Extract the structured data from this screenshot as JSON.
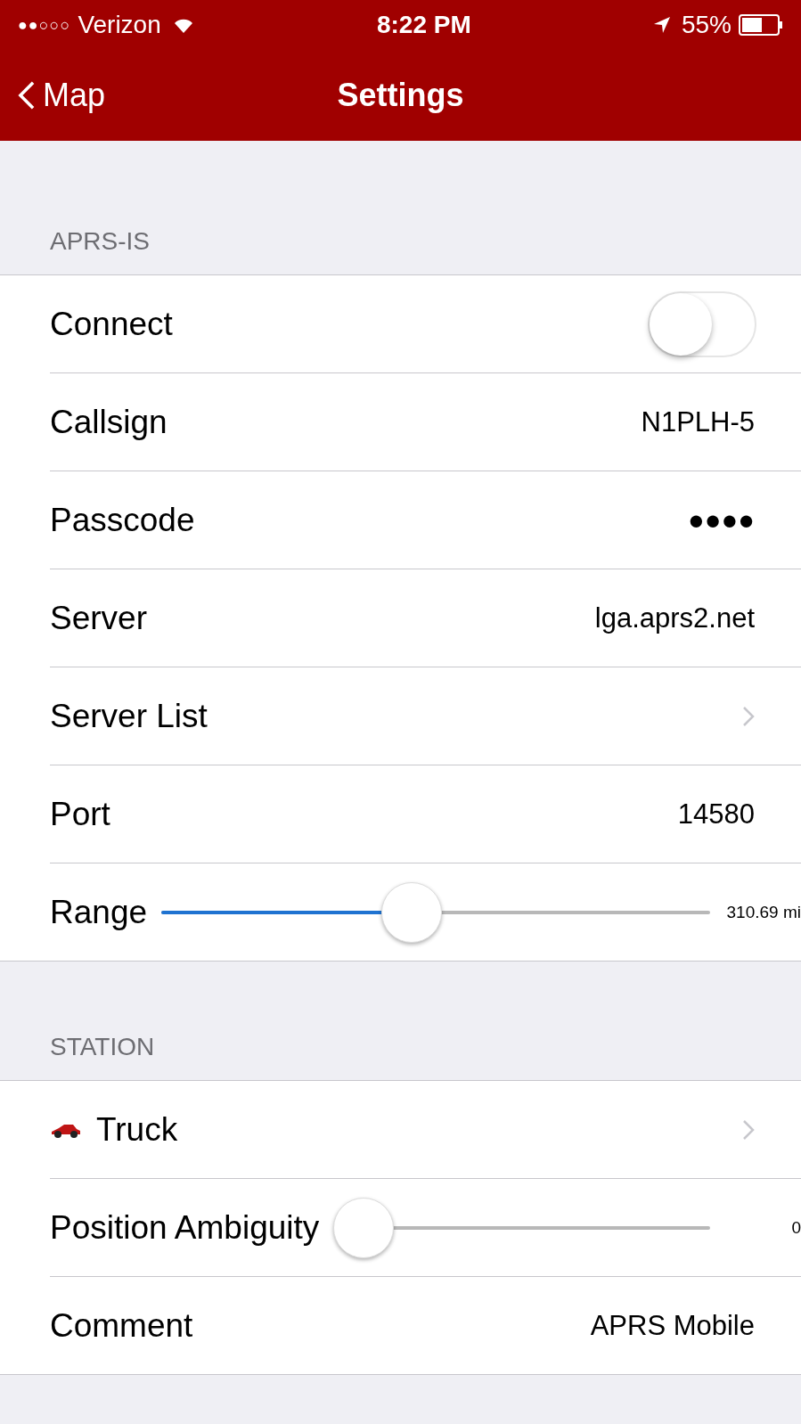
{
  "status_bar": {
    "signal_dots": "●●○○○",
    "carrier": "Verizon",
    "time": "8:22 PM",
    "battery": "55%"
  },
  "nav": {
    "back": "Map",
    "title": "Settings"
  },
  "sections": [
    {
      "header": "APRS-IS",
      "rows": [
        {
          "kind": "toggle",
          "label": "Connect",
          "on": false
        },
        {
          "kind": "value",
          "label": "Callsign",
          "value": "N1PLH-5"
        },
        {
          "kind": "value",
          "label": "Passcode",
          "value": "●●●●"
        },
        {
          "kind": "value",
          "label": "Server",
          "value": "lga.aprs2.net"
        },
        {
          "kind": "link",
          "label": "Server List"
        },
        {
          "kind": "value",
          "label": "Port",
          "value": "14580"
        },
        {
          "kind": "slider",
          "label": "Range",
          "level": 0.45,
          "reading": "310.69 mi"
        }
      ]
    },
    {
      "header": "STATION",
      "rows": [
        {
          "kind": "vehicle",
          "label": "Truck"
        },
        {
          "kind": "slider",
          "label": "Position Ambiguity",
          "level": 0,
          "reading": "0"
        },
        {
          "kind": "value",
          "label": "Comment",
          "value": "APRS Mobile"
        }
      ]
    }
  ]
}
